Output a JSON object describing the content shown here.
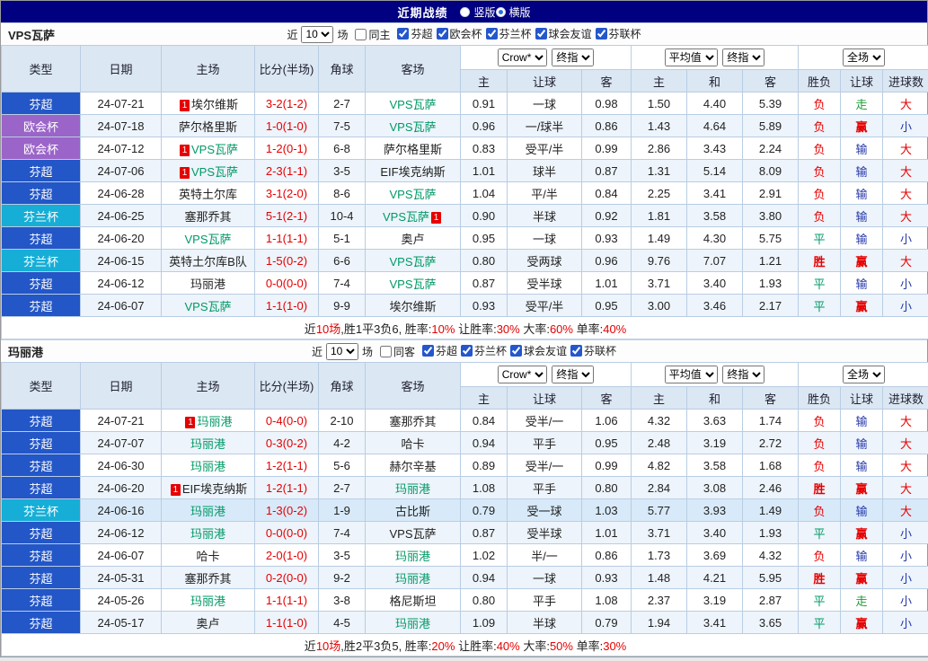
{
  "topbar": {
    "title": "近期战绩",
    "radios": [
      {
        "label": "竖版",
        "selected": false
      },
      {
        "label": "横版",
        "selected": true
      }
    ]
  },
  "columns": {
    "row1": [
      "类型",
      "日期",
      "主场",
      "比分(半场)",
      "角球",
      "客场"
    ],
    "row2": [
      "主",
      "让球",
      "客",
      "主",
      "和",
      "客",
      "胜负",
      "让球",
      "进球数"
    ]
  },
  "colors": {
    "type": {
      "芬超": "#2356c7",
      "欧会杯": "#9a64c8",
      "芬兰杯": "#16aed6"
    },
    "team_highlight": "#009966",
    "score": "#e60000",
    "result": {
      "胜": "#e60000",
      "平": "#009966",
      "负": "#e60000",
      "赢": "#e60000",
      "输": "#2437a8",
      "走": "#1f9c3a",
      "大": "#e60000",
      "小": "#2437a8"
    },
    "bold_results": [
      "胜",
      "赢"
    ]
  },
  "sections": [
    {
      "team": "VPS瓦萨",
      "filter": {
        "near": "近",
        "count": "10",
        "games": "场",
        "same": {
          "label": "同主",
          "checked": false
        },
        "comps": [
          {
            "label": "芬超",
            "checked": true
          },
          {
            "label": "欧会杯",
            "checked": true
          },
          {
            "label": "芬兰杯",
            "checked": true
          },
          {
            "label": "球会友谊",
            "checked": true
          },
          {
            "label": "芬联杯",
            "checked": true
          }
        ]
      },
      "selects": {
        "odds1": "Crow*",
        "odds1b": "终指",
        "odds2": "平均值",
        "odds2b": "终指",
        "scope": "全场"
      },
      "rows": [
        {
          "type": "芬超",
          "date": "24-07-21",
          "home": "埃尔维斯",
          "home_badge": "1",
          "score": "3-2(1-2)",
          "corner": "2-7",
          "away": "VPS瓦萨",
          "away_focus": true,
          "ah": [
            "0.91",
            "一球",
            "0.98"
          ],
          "eu": [
            "1.50",
            "4.40",
            "5.39"
          ],
          "res": [
            "负",
            "走",
            "大"
          ]
        },
        {
          "type": "欧会杯",
          "date": "24-07-18",
          "home": "萨尔格里斯",
          "score": "1-0(1-0)",
          "corner": "7-5",
          "away": "VPS瓦萨",
          "away_focus": true,
          "ah": [
            "0.96",
            "一/球半",
            "0.86"
          ],
          "eu": [
            "1.43",
            "4.64",
            "5.89"
          ],
          "res": [
            "负",
            "赢",
            "小"
          ]
        },
        {
          "type": "欧会杯",
          "date": "24-07-12",
          "home": "VPS瓦萨",
          "home_badge": "1",
          "home_focus": true,
          "score": "1-2(0-1)",
          "corner": "6-8",
          "away": "萨尔格里斯",
          "ah": [
            "0.83",
            "受平/半",
            "0.99"
          ],
          "eu": [
            "2.86",
            "3.43",
            "2.24"
          ],
          "res": [
            "负",
            "输",
            "大"
          ]
        },
        {
          "type": "芬超",
          "date": "24-07-06",
          "home": "VPS瓦萨",
          "home_badge": "1",
          "home_focus": true,
          "score": "2-3(1-1)",
          "corner": "3-5",
          "away": "EIF埃克纳斯",
          "ah": [
            "1.01",
            "球半",
            "0.87"
          ],
          "eu": [
            "1.31",
            "5.14",
            "8.09"
          ],
          "res": [
            "负",
            "输",
            "大"
          ]
        },
        {
          "type": "芬超",
          "date": "24-06-28",
          "home": "英特土尔库",
          "score": "3-1(2-0)",
          "corner": "8-6",
          "away": "VPS瓦萨",
          "away_focus": true,
          "ah": [
            "1.04",
            "平/半",
            "0.84"
          ],
          "eu": [
            "2.25",
            "3.41",
            "2.91"
          ],
          "res": [
            "负",
            "输",
            "大"
          ]
        },
        {
          "type": "芬兰杯",
          "date": "24-06-25",
          "home": "塞那乔其",
          "score": "5-1(2-1)",
          "corner": "10-4",
          "away": "VPS瓦萨",
          "away_focus": true,
          "away_badge": "1",
          "ah": [
            "0.90",
            "半球",
            "0.92"
          ],
          "eu": [
            "1.81",
            "3.58",
            "3.80"
          ],
          "res": [
            "负",
            "输",
            "大"
          ]
        },
        {
          "type": "芬超",
          "date": "24-06-20",
          "home": "VPS瓦萨",
          "home_focus": true,
          "score": "1-1(1-1)",
          "corner": "5-1",
          "away": "奥卢",
          "ah": [
            "0.95",
            "一球",
            "0.93"
          ],
          "eu": [
            "1.49",
            "4.30",
            "5.75"
          ],
          "res": [
            "平",
            "输",
            "小"
          ]
        },
        {
          "type": "芬兰杯",
          "date": "24-06-15",
          "home": "英特土尔库B队",
          "score": "1-5(0-2)",
          "corner": "6-6",
          "away": "VPS瓦萨",
          "away_focus": true,
          "ah": [
            "0.80",
            "受两球",
            "0.96"
          ],
          "eu": [
            "9.76",
            "7.07",
            "1.21"
          ],
          "res": [
            "胜",
            "赢",
            "大"
          ]
        },
        {
          "type": "芬超",
          "date": "24-06-12",
          "home": "玛丽港",
          "score": "0-0(0-0)",
          "corner": "7-4",
          "away": "VPS瓦萨",
          "away_focus": true,
          "ah": [
            "0.87",
            "受半球",
            "1.01"
          ],
          "eu": [
            "3.71",
            "3.40",
            "1.93"
          ],
          "res": [
            "平",
            "输",
            "小"
          ]
        },
        {
          "type": "芬超",
          "date": "24-06-07",
          "home": "VPS瓦萨",
          "home_focus": true,
          "score": "1-1(1-0)",
          "corner": "9-9",
          "away": "埃尔维斯",
          "ah": [
            "0.93",
            "受平/半",
            "0.95"
          ],
          "eu": [
            "3.00",
            "3.46",
            "2.17"
          ],
          "res": [
            "平",
            "赢",
            "小"
          ]
        }
      ],
      "summary": [
        {
          "t": "近"
        },
        {
          "t": "10场",
          "red": true
        },
        {
          "t": ",胜1平3负6, 胜率:"
        },
        {
          "t": "10%",
          "red": true
        },
        {
          "t": " 让胜率:"
        },
        {
          "t": "30%",
          "red": true
        },
        {
          "t": " 大率:"
        },
        {
          "t": "60%",
          "red": true
        },
        {
          "t": " 单率:"
        },
        {
          "t": "40%",
          "red": true
        }
      ]
    },
    {
      "team": "玛丽港",
      "filter": {
        "near": "近",
        "count": "10",
        "games": "场",
        "same": {
          "label": "同客",
          "checked": false
        },
        "comps": [
          {
            "label": "芬超",
            "checked": true
          },
          {
            "label": "芬兰杯",
            "checked": true
          },
          {
            "label": "球会友谊",
            "checked": true
          },
          {
            "label": "芬联杯",
            "checked": true
          }
        ]
      },
      "selects": {
        "odds1": "Crow*",
        "odds1b": "终指",
        "odds2": "平均值",
        "odds2b": "终指",
        "scope": "全场"
      },
      "rows": [
        {
          "type": "芬超",
          "date": "24-07-21",
          "home": "玛丽港",
          "home_badge": "1",
          "home_focus": true,
          "score": "0-4(0-0)",
          "corner": "2-10",
          "away": "塞那乔其",
          "ah": [
            "0.84",
            "受半/一",
            "1.06"
          ],
          "eu": [
            "4.32",
            "3.63",
            "1.74"
          ],
          "res": [
            "负",
            "输",
            "大"
          ]
        },
        {
          "type": "芬超",
          "date": "24-07-07",
          "home": "玛丽港",
          "home_focus": true,
          "score": "0-3(0-2)",
          "corner": "4-2",
          "away": "哈卡",
          "ah": [
            "0.94",
            "平手",
            "0.95"
          ],
          "eu": [
            "2.48",
            "3.19",
            "2.72"
          ],
          "res": [
            "负",
            "输",
            "大"
          ]
        },
        {
          "type": "芬超",
          "date": "24-06-30",
          "home": "玛丽港",
          "home_focus": true,
          "score": "1-2(1-1)",
          "corner": "5-6",
          "away": "赫尔辛基",
          "ah": [
            "0.89",
            "受半/一",
            "0.99"
          ],
          "eu": [
            "4.82",
            "3.58",
            "1.68"
          ],
          "res": [
            "负",
            "输",
            "大"
          ]
        },
        {
          "type": "芬超",
          "date": "24-06-20",
          "home": "EIF埃克纳斯",
          "home_badge": "1",
          "score": "1-2(1-1)",
          "corner": "2-7",
          "away": "玛丽港",
          "away_focus": true,
          "ah": [
            "1.08",
            "平手",
            "0.80"
          ],
          "eu": [
            "2.84",
            "3.08",
            "2.46"
          ],
          "res": [
            "胜",
            "赢",
            "大"
          ]
        },
        {
          "type": "芬兰杯",
          "date": "24-06-16",
          "home": "玛丽港",
          "home_focus": true,
          "hl": true,
          "score": "1-3(0-2)",
          "corner": "1-9",
          "away": "古比斯",
          "ah": [
            "0.79",
            "受一球",
            "1.03"
          ],
          "eu": [
            "5.77",
            "3.93",
            "1.49"
          ],
          "res": [
            "负",
            "输",
            "大"
          ]
        },
        {
          "type": "芬超",
          "date": "24-06-12",
          "home": "玛丽港",
          "home_focus": true,
          "score": "0-0(0-0)",
          "corner": "7-4",
          "away": "VPS瓦萨",
          "ah": [
            "0.87",
            "受半球",
            "1.01"
          ],
          "eu": [
            "3.71",
            "3.40",
            "1.93"
          ],
          "res": [
            "平",
            "赢",
            "小"
          ]
        },
        {
          "type": "芬超",
          "date": "24-06-07",
          "home": "哈卡",
          "score": "2-0(1-0)",
          "corner": "3-5",
          "away": "玛丽港",
          "away_focus": true,
          "ah": [
            "1.02",
            "半/一",
            "0.86"
          ],
          "eu": [
            "1.73",
            "3.69",
            "4.32"
          ],
          "res": [
            "负",
            "输",
            "小"
          ]
        },
        {
          "type": "芬超",
          "date": "24-05-31",
          "home": "塞那乔其",
          "score": "0-2(0-0)",
          "corner": "9-2",
          "away": "玛丽港",
          "away_focus": true,
          "ah": [
            "0.94",
            "一球",
            "0.93"
          ],
          "eu": [
            "1.48",
            "4.21",
            "5.95"
          ],
          "res": [
            "胜",
            "赢",
            "小"
          ]
        },
        {
          "type": "芬超",
          "date": "24-05-26",
          "home": "玛丽港",
          "home_focus": true,
          "score": "1-1(1-1)",
          "corner": "3-8",
          "away": "格尼斯坦",
          "ah": [
            "0.80",
            "平手",
            "1.08"
          ],
          "eu": [
            "2.37",
            "3.19",
            "2.87"
          ],
          "res": [
            "平",
            "走",
            "小"
          ]
        },
        {
          "type": "芬超",
          "date": "24-05-17",
          "home": "奥卢",
          "score": "1-1(1-0)",
          "corner": "4-5",
          "away": "玛丽港",
          "away_focus": true,
          "ah": [
            "1.09",
            "半球",
            "0.79"
          ],
          "eu": [
            "1.94",
            "3.41",
            "3.65"
          ],
          "res": [
            "平",
            "赢",
            "小"
          ]
        }
      ],
      "summary": [
        {
          "t": "近"
        },
        {
          "t": "10场",
          "red": true
        },
        {
          "t": ",胜2平3负5, 胜率:"
        },
        {
          "t": "20%",
          "red": true
        },
        {
          "t": " 让胜率:"
        },
        {
          "t": "40%",
          "red": true
        },
        {
          "t": " 大率:"
        },
        {
          "t": "50%",
          "red": true
        },
        {
          "t": " 单率:"
        },
        {
          "t": "30%",
          "red": true
        }
      ]
    }
  ]
}
